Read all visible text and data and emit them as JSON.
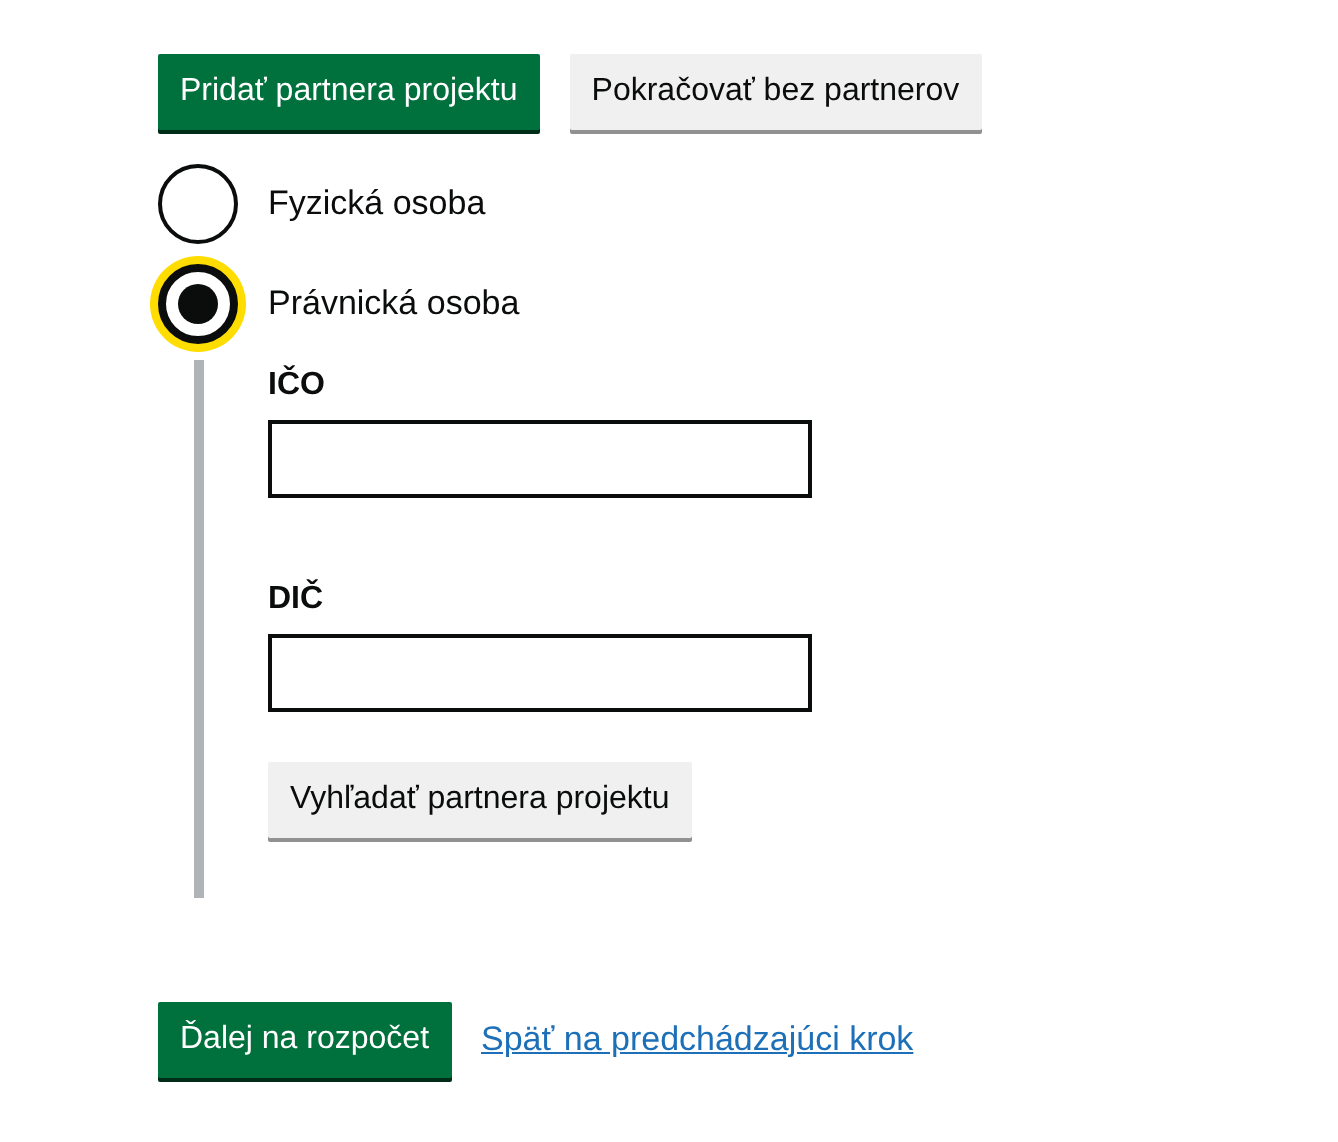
{
  "top_buttons": [
    {
      "label": "Pridať partnera projektu",
      "kind": "primary"
    },
    {
      "label": "Pokračovať bez partnerov",
      "kind": "secondary"
    }
  ],
  "partner_type": [
    {
      "label": "Fyzická osoba",
      "selected": false,
      "focused": false
    },
    {
      "label": "Právnická osoba",
      "selected": true,
      "focused": true
    }
  ],
  "fields": [
    {
      "label": "IČO"
    },
    {
      "label": "DIČ"
    }
  ],
  "search_button": {
    "label": "Vyhľadať partnera projektu",
    "kind": "secondary"
  },
  "footer": {
    "next_button": {
      "label": "Ďalej na rozpočet",
      "kind": "primary"
    },
    "back_link": "Späť na predchádzajúci krok"
  }
}
